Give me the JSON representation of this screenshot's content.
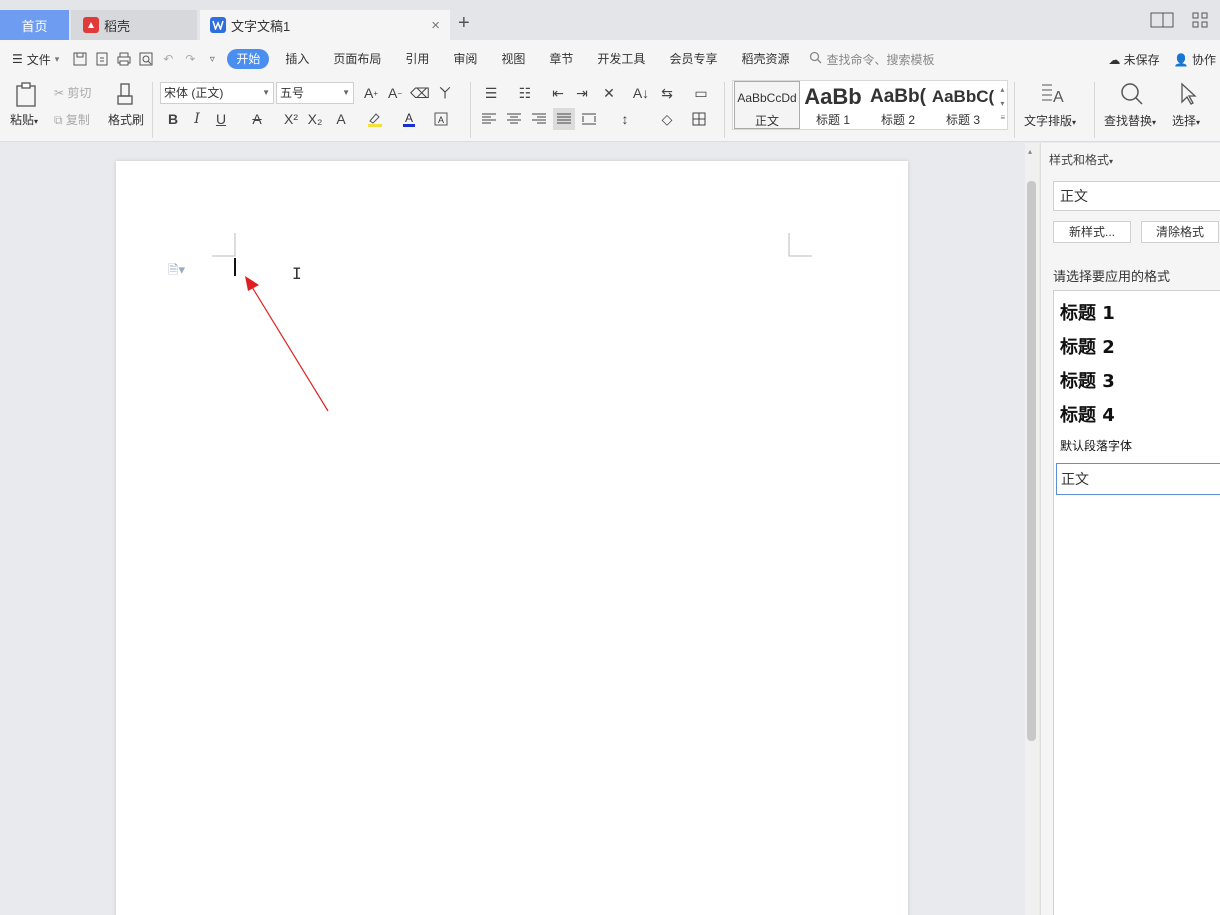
{
  "tabs": {
    "home": "首页",
    "daoke": "稻壳",
    "doc": "文字文稿1",
    "close": "×",
    "add": "+"
  },
  "menu": {
    "file": "文件",
    "items": [
      "开始",
      "插入",
      "页面布局",
      "引用",
      "审阅",
      "视图",
      "章节",
      "开发工具",
      "会员专享",
      "稻壳资源"
    ],
    "search": "查找命令、搜索模板",
    "unsaved": "未保存",
    "collab": "协作"
  },
  "ribbon": {
    "paste": "粘贴",
    "cut": "剪切",
    "copy": "复制",
    "format_painter": "格式刷",
    "font_name": "宋体 (正文)",
    "font_size": "五号",
    "styles": [
      {
        "sample": "AaBbCcDd",
        "label": "正文"
      },
      {
        "sample": "AaBb",
        "label": "标题 1"
      },
      {
        "sample": "AaBb(",
        "label": "标题 2"
      },
      {
        "sample": "AaBbC(",
        "label": "标题 3"
      }
    ],
    "text_layout": "文字排版",
    "find_replace": "查找替换",
    "select": "选择"
  },
  "panel": {
    "title": "样式和格式",
    "current_style": "正文",
    "new_style": "新样式...",
    "clear_format": "清除格式",
    "apply_label": "请选择要应用的格式",
    "list": [
      "标题 1",
      "标题 2",
      "标题 3",
      "标题 4",
      "默认段落字体",
      "正文"
    ]
  },
  "colors": {
    "accent": "#4a8ef0",
    "home_tab": "#6d9cf0",
    "annotation_arrow": "#e02020"
  }
}
